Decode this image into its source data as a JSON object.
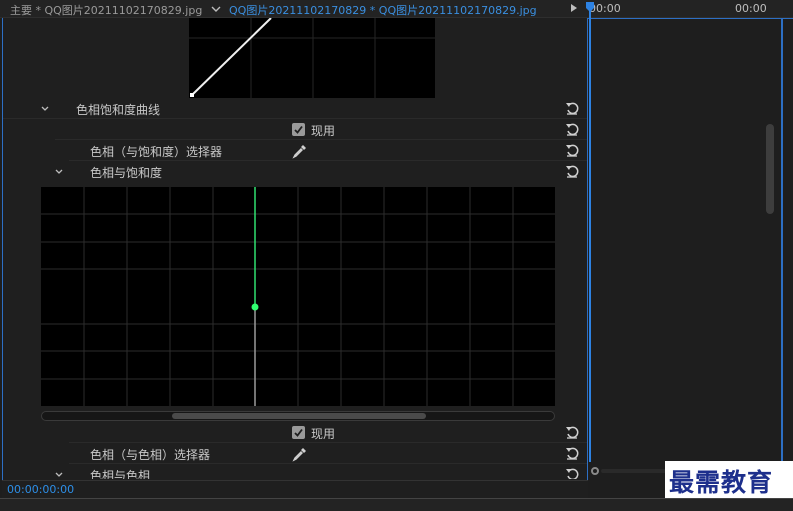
{
  "tabs": {
    "main_tab": "主要 * QQ图片20211102170829.jpg",
    "active_tab": "QQ图片20211102170829 * QQ图片20211102170829.jpg"
  },
  "timeline": {
    "head_time": "00:00",
    "head_time_right": "00:00"
  },
  "effect_controls": {
    "section_hue_sat_curves": "色相饱和度曲线",
    "enable_label": "现用",
    "hue_vs_sat_selector": "色相（与饱和度）选择器",
    "hue_vs_sat_subsection": "色相与饱和度",
    "enable_label_2": "现用",
    "hue_vs_hue_selector": "色相（与色相）选择器",
    "hue_vs_hue_subsection": "色相与色相"
  },
  "status": {
    "timecode": "00:00:00:00"
  },
  "watermark": {
    "text": "最需教育"
  },
  "colors": {
    "accent": "#2d82e3",
    "panel_bg": "#1f1f1f"
  },
  "icons": [
    "chevron-down-icon",
    "reset-icon",
    "checkbox-checked-icon",
    "eyedropper-icon",
    "play-icon"
  ]
}
